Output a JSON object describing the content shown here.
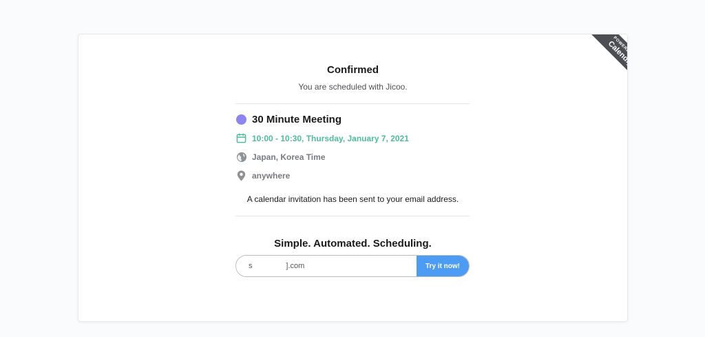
{
  "badge": {
    "powered_by": "POWERED BY",
    "brand": "Calendly"
  },
  "confirmation": {
    "title": "Confirmed",
    "subtitle": "You are scheduled with Jicoo."
  },
  "event": {
    "name": "30 Minute Meeting",
    "color": "#8b84f1",
    "datetime": "10:00 - 10:30, Thursday, January 7, 2021",
    "timezone": "Japan, Korea Time",
    "location": "anywhere"
  },
  "invite_notice": "A calendar invitation has been sent to your email address.",
  "promo": {
    "tagline": "Simple. Automated. Scheduling.",
    "email_value": "s                ].com",
    "button_label": "Try it now!"
  },
  "colors": {
    "accent": "#4b9cf2",
    "datetime": "#4ebc9b",
    "badge_bg": "#4b4f54"
  },
  "icons": {
    "event_color": "event-color-dot-icon",
    "calendar": "calendar-icon",
    "timezone": "globe-icon",
    "location": "location-pin-icon"
  }
}
